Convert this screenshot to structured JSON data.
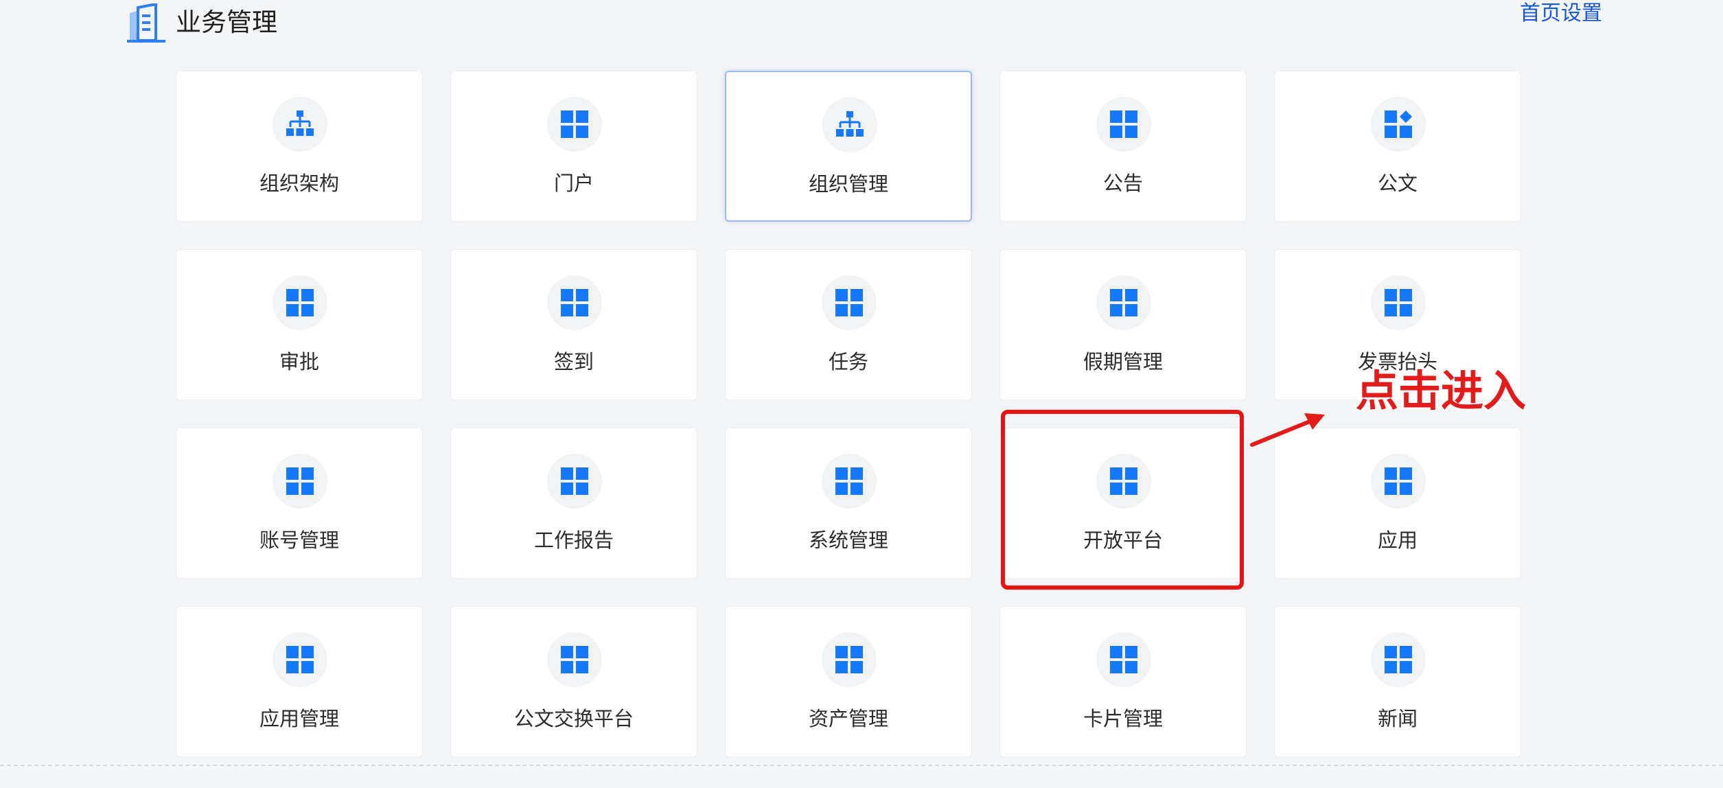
{
  "header": {
    "title": "业务管理",
    "home_settings": "首页设置"
  },
  "modules": [
    {
      "label": "组织架构",
      "icon": "org-chart-icon"
    },
    {
      "label": "门户",
      "icon": "grid-icon"
    },
    {
      "label": "组织管理",
      "icon": "org-chart-icon",
      "active": true
    },
    {
      "label": "公告",
      "icon": "grid-icon"
    },
    {
      "label": "公文",
      "icon": "shapes-icon"
    },
    {
      "label": "审批",
      "icon": "grid-icon"
    },
    {
      "label": "签到",
      "icon": "grid-icon"
    },
    {
      "label": "任务",
      "icon": "grid-icon"
    },
    {
      "label": "假期管理",
      "icon": "grid-icon"
    },
    {
      "label": "发票抬头",
      "icon": "grid-icon"
    },
    {
      "label": "账号管理",
      "icon": "grid-icon"
    },
    {
      "label": "工作报告",
      "icon": "grid-icon"
    },
    {
      "label": "系统管理",
      "icon": "grid-icon"
    },
    {
      "label": "开放平台",
      "icon": "grid-icon",
      "highlighted": true
    },
    {
      "label": "应用",
      "icon": "grid-icon"
    },
    {
      "label": "应用管理",
      "icon": "grid-icon"
    },
    {
      "label": "公文交换平台",
      "icon": "grid-icon"
    },
    {
      "label": "资产管理",
      "icon": "grid-icon"
    },
    {
      "label": "卡片管理",
      "icon": "grid-icon"
    },
    {
      "label": "新闻",
      "icon": "grid-icon"
    }
  ],
  "annotation": {
    "text": "点击进入"
  },
  "colors": {
    "accent": "#1677ff",
    "link": "#1a57d6",
    "highlight": "#ea1313",
    "background": "#f4f5f7"
  }
}
